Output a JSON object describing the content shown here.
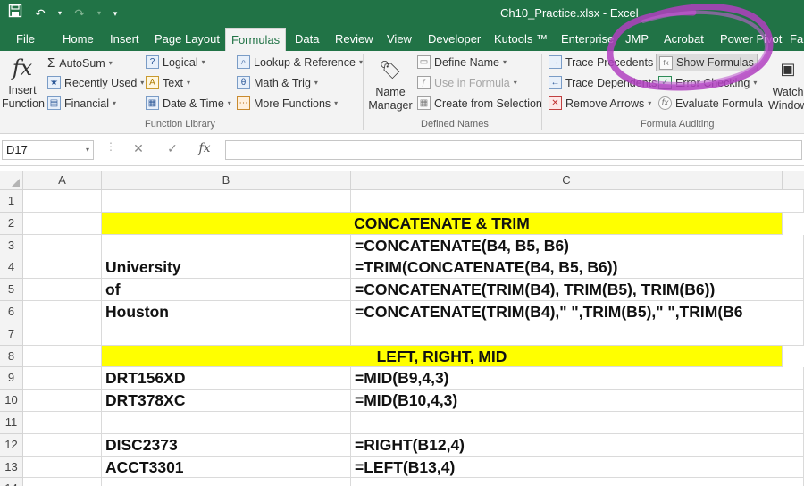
{
  "window": {
    "title": "Ch10_Practice.xlsx - Excel"
  },
  "qat": {
    "save_icon": "save-icon",
    "undo_icon": "undo-icon",
    "redo_icon": "redo-icon",
    "customize_icon": "customize-qat-icon"
  },
  "tabs": [
    {
      "label": "File"
    },
    {
      "label": "Home"
    },
    {
      "label": "Insert"
    },
    {
      "label": "Page Layout"
    },
    {
      "label": "Formulas",
      "active": true
    },
    {
      "label": "Data"
    },
    {
      "label": "Review"
    },
    {
      "label": "View"
    },
    {
      "label": "Developer"
    },
    {
      "label": "Kutools ™"
    },
    {
      "label": "Enterprise"
    },
    {
      "label": "JMP"
    },
    {
      "label": "Acrobat"
    },
    {
      "label": "Power Pivot"
    },
    {
      "label": "Fa"
    }
  ],
  "ribbon": {
    "insert_function": {
      "line1": "Insert",
      "line2": "Function"
    },
    "function_library": {
      "label": "Function Library",
      "autosum": "AutoSum",
      "recently_used": "Recently Used",
      "financial": "Financial",
      "logical": "Logical",
      "text": "Text",
      "date_time": "Date & Time",
      "lookup_reference": "Lookup & Reference",
      "math_trig": "Math & Trig",
      "more_functions": "More Functions"
    },
    "defined_names": {
      "label": "Defined Names",
      "name_manager_1": "Name",
      "name_manager_2": "Manager",
      "define_name": "Define Name",
      "use_in_formula": "Use in Formula",
      "create_from_selection": "Create from Selection"
    },
    "formula_auditing": {
      "label": "Formula Auditing",
      "trace_precedents": "Trace Precedents",
      "trace_dependents": "Trace Dependents",
      "remove_arrows": "Remove Arrows",
      "show_formulas": "Show Formulas",
      "error_checking": "Error Checking",
      "evaluate_formula": "Evaluate Formula",
      "watch_1": "Watch",
      "watch_2": "Window"
    }
  },
  "formula_bar": {
    "name_box": "D17",
    "formula": "",
    "cancel_icon": "cancel-icon",
    "enter_icon": "enter-icon",
    "fx_label": "fx"
  },
  "columns": [
    "A",
    "B",
    "C"
  ],
  "rows": [
    {
      "num": "1",
      "b": "",
      "c": ""
    },
    {
      "num": "2",
      "b": "",
      "c": "CONCATENATE & TRIM",
      "header": true
    },
    {
      "num": "3",
      "b": "",
      "c": "=CONCATENATE(B4, B5, B6)"
    },
    {
      "num": "4",
      "b": "University",
      "c": "=TRIM(CONCATENATE(B4, B5, B6))"
    },
    {
      "num": "5",
      "b": "of",
      "c": "=CONCATENATE(TRIM(B4), TRIM(B5), TRIM(B6))"
    },
    {
      "num": "6",
      "b": "Houston",
      "c": "=CONCATENATE(TRIM(B4),\" \",TRIM(B5),\" \",TRIM(B6"
    },
    {
      "num": "7",
      "b": "",
      "c": ""
    },
    {
      "num": "8",
      "b": "",
      "c": "LEFT, RIGHT, MID",
      "header": true
    },
    {
      "num": "9",
      "b": "DRT156XD",
      "c": "=MID(B9,4,3)"
    },
    {
      "num": "10",
      "b": "DRT378XC",
      "c": "=MID(B10,4,3)"
    },
    {
      "num": "11",
      "b": "",
      "c": ""
    },
    {
      "num": "12",
      "b": "DISC2373",
      "c": "=RIGHT(B12,4)"
    },
    {
      "num": "13",
      "b": "ACCT3301",
      "c": "=LEFT(B13,4)"
    },
    {
      "num": "14",
      "b": "",
      "c": ""
    }
  ],
  "colors": {
    "excel_green": "#217346",
    "highlight_yellow": "#ffff00",
    "annotation_purple": "#b040c0"
  }
}
